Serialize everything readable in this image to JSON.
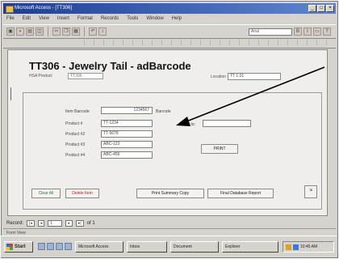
{
  "window": {
    "title": "Microsoft Access - [TT306]",
    "controls": [
      "_",
      "□",
      "×"
    ]
  },
  "menubar": {
    "items": [
      "File",
      "Edit",
      "View",
      "Insert",
      "Format",
      "Records",
      "Tools",
      "Window",
      "Help"
    ]
  },
  "toolbar": {
    "combo_value": "Arial"
  },
  "document": {
    "title": "TT306 - Jewelry Tail - adBarcode",
    "subtitle": "HSA Product",
    "subtitle_value": "TT306",
    "location_label": "Location",
    "location_value": "TT 1.01"
  },
  "form": {
    "fields": [
      {
        "label": "Item Barcode",
        "value": "1234567"
      },
      {
        "label": "Product #",
        "value": "TT-1234"
      },
      {
        "label": "Product #2",
        "value": "TT-5678"
      },
      {
        "label": "Product #3",
        "value": "ABC-123"
      },
      {
        "label": "Product #4",
        "value": "ABC-456"
      }
    ],
    "barcode_suffix": "Barcode",
    "how_to_label": "How to:",
    "how_to_value": "",
    "print_label": "PRINT"
  },
  "buttons": {
    "clear": "Clear All",
    "delete": "Delete Item",
    "print_summary": "Print Summary Copy",
    "final_database_report": "Final Database Report",
    "exit": "Exit"
  },
  "statusbar": {
    "record_label": "Record:",
    "record_value": "1",
    "page_info": "of 1",
    "mode": "Form View"
  },
  "taskbar": {
    "start_label": "Start",
    "tasks": [
      "Microsoft Access",
      "Inbox",
      "Document",
      "Explorer"
    ],
    "clock": "10:45 AM"
  }
}
